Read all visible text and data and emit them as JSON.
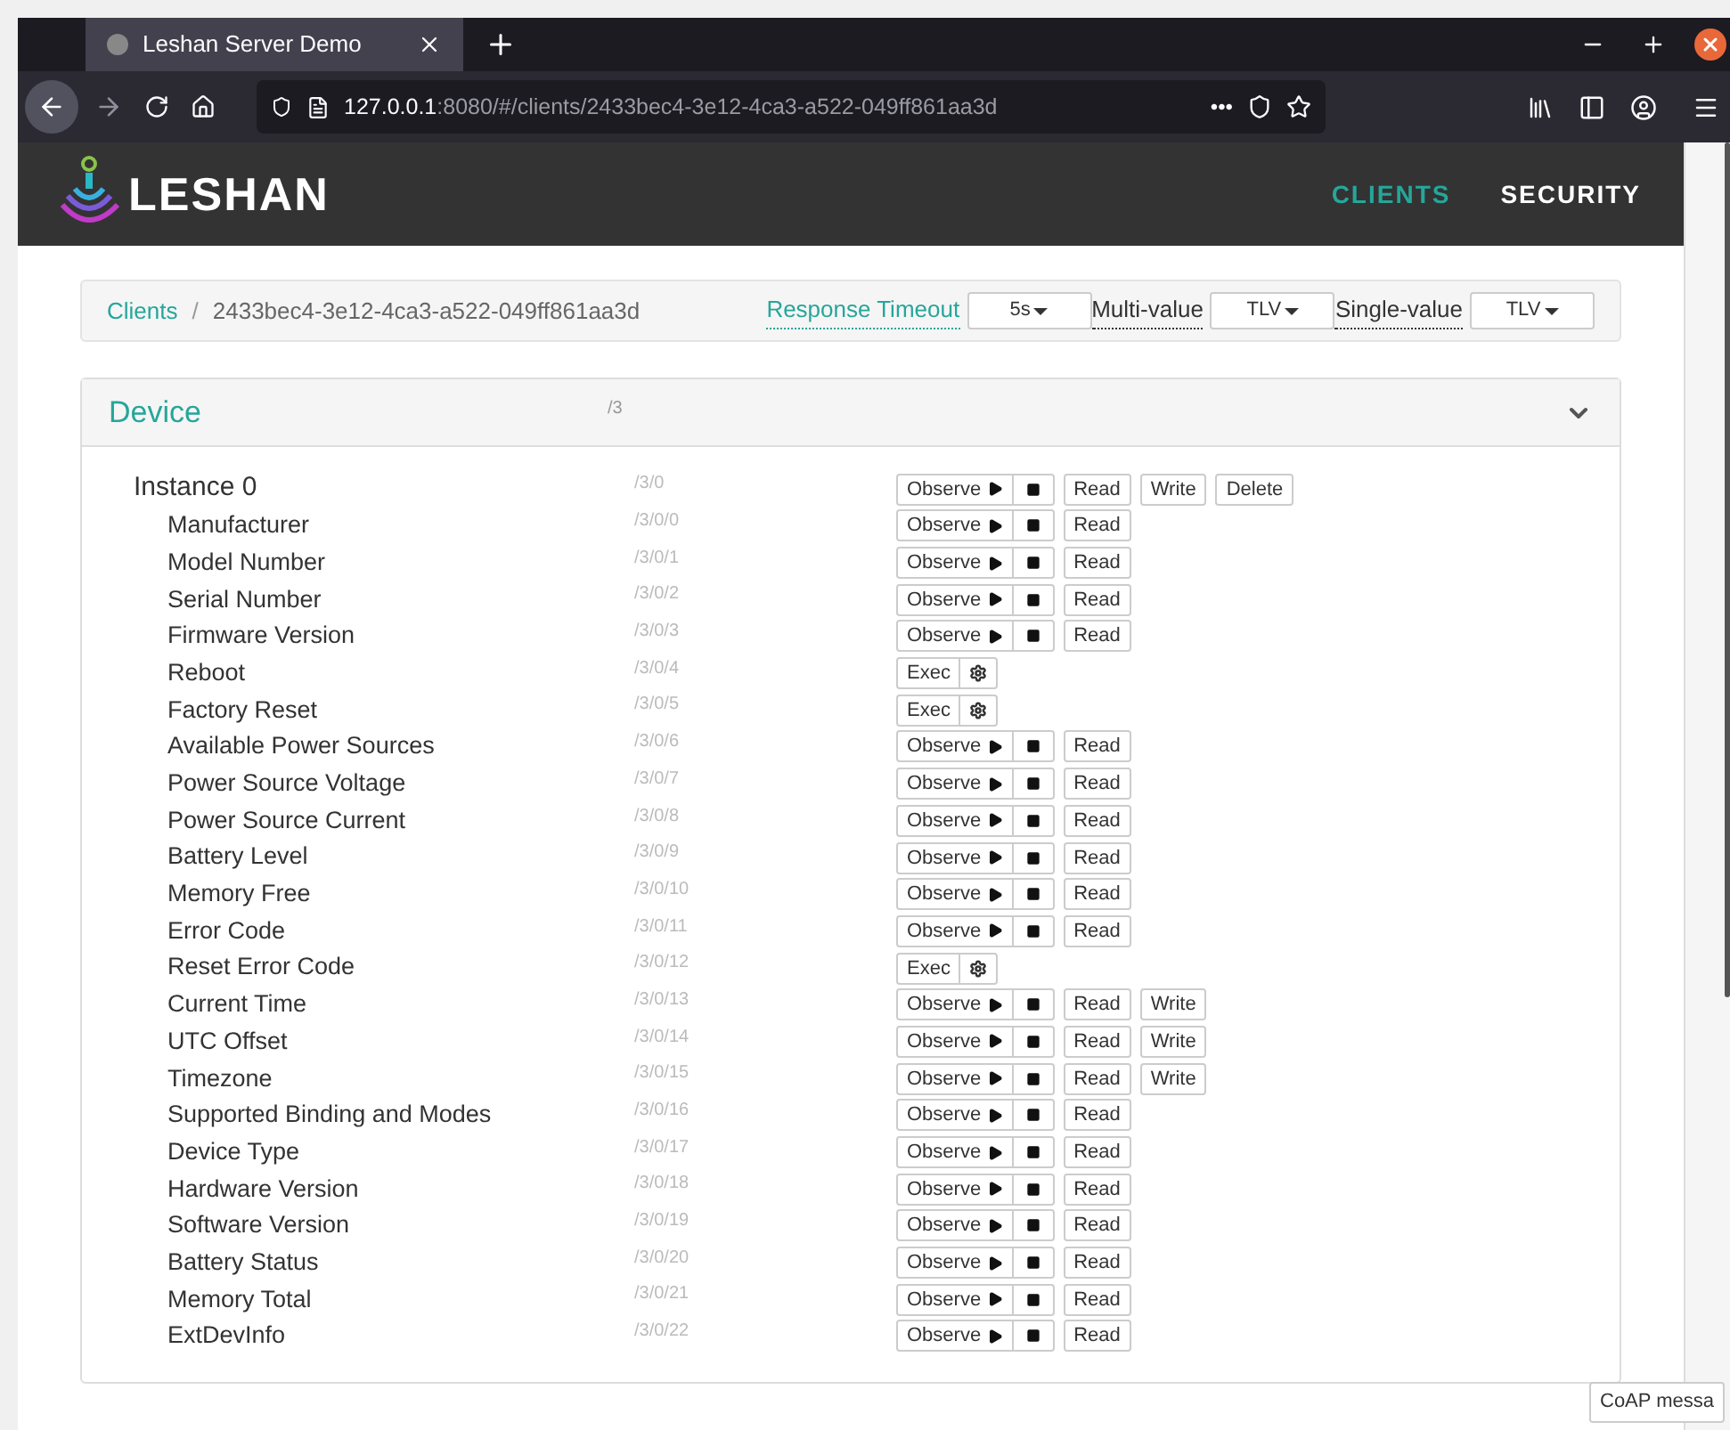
{
  "browser": {
    "tab_title": "Leshan Server Demo",
    "url_host": "127.0.0.1",
    "url_rest": ":8080/#/clients/2433bec4-3e12-4ca3-a522-049ff861aa3d",
    "page_actions": "•••"
  },
  "header": {
    "logo": "LESHAN",
    "nav": [
      {
        "label": "CLIENTS",
        "selected": true
      },
      {
        "label": "SECURITY",
        "selected": false
      }
    ]
  },
  "breadcrumb": {
    "items": [
      "Clients",
      "2433bec4-3e12-4ca3-a522-049ff861aa3d"
    ],
    "separator": "/",
    "settings": [
      {
        "label": "Response Timeout",
        "value": "5s",
        "selected": true
      },
      {
        "label": "Multi-value",
        "value": "TLV",
        "selected": false
      },
      {
        "label": "Single-value",
        "value": "TLV",
        "selected": false
      }
    ]
  },
  "object": {
    "name": "Device",
    "path": "/3",
    "expanded": true,
    "instance": {
      "name": "Instance 0",
      "path": "/3/0",
      "ops": [
        {
          "kind": "observe",
          "label": "Observe"
        },
        {
          "kind": "plain",
          "label": "Read"
        },
        {
          "kind": "plain",
          "label": "Write"
        },
        {
          "kind": "plain",
          "label": "Delete"
        }
      ]
    },
    "resources": [
      {
        "name": "Manufacturer",
        "path": "/3/0/0",
        "ops": [
          {
            "kind": "observe",
            "label": "Observe"
          },
          {
            "kind": "plain",
            "label": "Read"
          }
        ]
      },
      {
        "name": "Model Number",
        "path": "/3/0/1",
        "ops": [
          {
            "kind": "observe",
            "label": "Observe"
          },
          {
            "kind": "plain",
            "label": "Read"
          }
        ]
      },
      {
        "name": "Serial Number",
        "path": "/3/0/2",
        "ops": [
          {
            "kind": "observe",
            "label": "Observe"
          },
          {
            "kind": "plain",
            "label": "Read"
          }
        ]
      },
      {
        "name": "Firmware Version",
        "path": "/3/0/3",
        "ops": [
          {
            "kind": "observe",
            "label": "Observe"
          },
          {
            "kind": "plain",
            "label": "Read"
          }
        ]
      },
      {
        "name": "Reboot",
        "path": "/3/0/4",
        "ops": [
          {
            "kind": "exec",
            "label": "Exec"
          }
        ]
      },
      {
        "name": "Factory Reset",
        "path": "/3/0/5",
        "ops": [
          {
            "kind": "exec",
            "label": "Exec"
          }
        ]
      },
      {
        "name": "Available Power Sources",
        "path": "/3/0/6",
        "ops": [
          {
            "kind": "observe",
            "label": "Observe"
          },
          {
            "kind": "plain",
            "label": "Read"
          }
        ]
      },
      {
        "name": "Power Source Voltage",
        "path": "/3/0/7",
        "ops": [
          {
            "kind": "observe",
            "label": "Observe"
          },
          {
            "kind": "plain",
            "label": "Read"
          }
        ]
      },
      {
        "name": "Power Source Current",
        "path": "/3/0/8",
        "ops": [
          {
            "kind": "observe",
            "label": "Observe"
          },
          {
            "kind": "plain",
            "label": "Read"
          }
        ]
      },
      {
        "name": "Battery Level",
        "path": "/3/0/9",
        "ops": [
          {
            "kind": "observe",
            "label": "Observe"
          },
          {
            "kind": "plain",
            "label": "Read"
          }
        ]
      },
      {
        "name": "Memory Free",
        "path": "/3/0/10",
        "ops": [
          {
            "kind": "observe",
            "label": "Observe"
          },
          {
            "kind": "plain",
            "label": "Read"
          }
        ]
      },
      {
        "name": "Error Code",
        "path": "/3/0/11",
        "ops": [
          {
            "kind": "observe",
            "label": "Observe"
          },
          {
            "kind": "plain",
            "label": "Read"
          }
        ]
      },
      {
        "name": "Reset Error Code",
        "path": "/3/0/12",
        "ops": [
          {
            "kind": "exec",
            "label": "Exec"
          }
        ]
      },
      {
        "name": "Current Time",
        "path": "/3/0/13",
        "ops": [
          {
            "kind": "observe",
            "label": "Observe"
          },
          {
            "kind": "plain",
            "label": "Read"
          },
          {
            "kind": "plain",
            "label": "Write"
          }
        ]
      },
      {
        "name": "UTC Offset",
        "path": "/3/0/14",
        "ops": [
          {
            "kind": "observe",
            "label": "Observe"
          },
          {
            "kind": "plain",
            "label": "Read"
          },
          {
            "kind": "plain",
            "label": "Write"
          }
        ]
      },
      {
        "name": "Timezone",
        "path": "/3/0/15",
        "ops": [
          {
            "kind": "observe",
            "label": "Observe"
          },
          {
            "kind": "plain",
            "label": "Read"
          },
          {
            "kind": "plain",
            "label": "Write"
          }
        ]
      },
      {
        "name": "Supported Binding and Modes",
        "path": "/3/0/16",
        "ops": [
          {
            "kind": "observe",
            "label": "Observe"
          },
          {
            "kind": "plain",
            "label": "Read"
          }
        ]
      },
      {
        "name": "Device Type",
        "path": "/3/0/17",
        "ops": [
          {
            "kind": "observe",
            "label": "Observe"
          },
          {
            "kind": "plain",
            "label": "Read"
          }
        ]
      },
      {
        "name": "Hardware Version",
        "path": "/3/0/18",
        "ops": [
          {
            "kind": "observe",
            "label": "Observe"
          },
          {
            "kind": "plain",
            "label": "Read"
          }
        ]
      },
      {
        "name": "Software Version",
        "path": "/3/0/19",
        "ops": [
          {
            "kind": "observe",
            "label": "Observe"
          },
          {
            "kind": "plain",
            "label": "Read"
          }
        ]
      },
      {
        "name": "Battery Status",
        "path": "/3/0/20",
        "ops": [
          {
            "kind": "observe",
            "label": "Observe"
          },
          {
            "kind": "plain",
            "label": "Read"
          }
        ]
      },
      {
        "name": "Memory Total",
        "path": "/3/0/21",
        "ops": [
          {
            "kind": "observe",
            "label": "Observe"
          },
          {
            "kind": "plain",
            "label": "Read"
          }
        ]
      },
      {
        "name": "ExtDevInfo",
        "path": "/3/0/22",
        "ops": [
          {
            "kind": "observe",
            "label": "Observe"
          },
          {
            "kind": "plain",
            "label": "Read"
          }
        ]
      }
    ]
  },
  "coap_button": "CoAP messa"
}
